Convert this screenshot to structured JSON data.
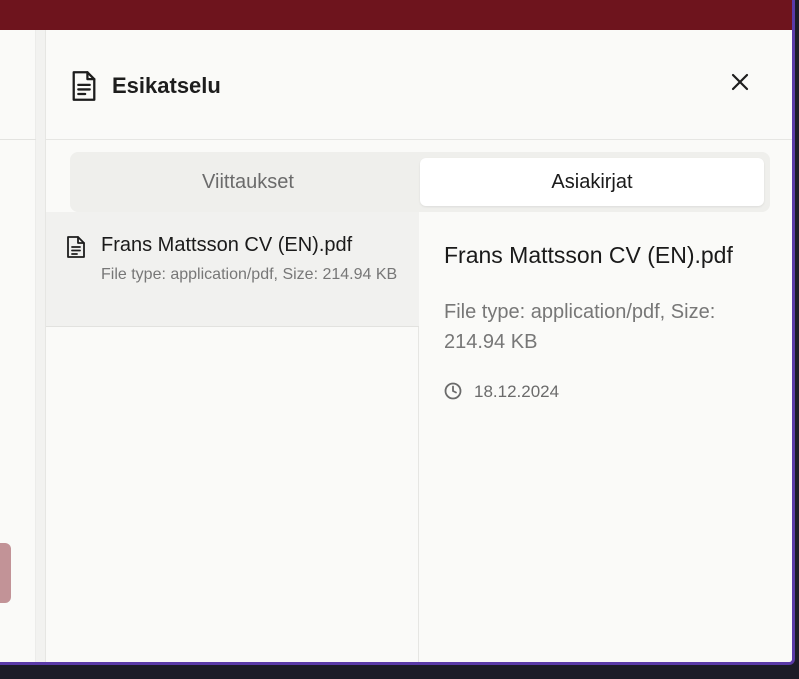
{
  "drawer": {
    "title": "Esikatselu",
    "header_icon": "document-icon",
    "close_icon": "close-icon"
  },
  "tabs": [
    {
      "label": "Viittaukset",
      "active": false
    },
    {
      "label": "Asiakirjat",
      "active": true
    }
  ],
  "documents": [
    {
      "name": "Frans Mattsson CV (EN).pdf",
      "meta": "File type: application/pdf, Size: 214.94 KB",
      "icon": "document-icon"
    }
  ],
  "detail": {
    "name": "Frans Mattsson CV (EN).pdf",
    "meta": "File type: application/pdf, Size: 214.94 KB",
    "date": "18.12.2024",
    "date_icon": "clock-icon"
  },
  "colors": {
    "top_bar": "#6e141d",
    "frame_border": "#5a3aa8",
    "background_pill": "#c29397"
  }
}
